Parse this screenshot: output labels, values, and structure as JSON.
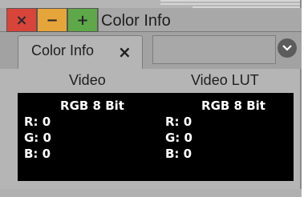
{
  "window": {
    "title": "Color Info",
    "buttons": {
      "close": "×",
      "minimize": "−",
      "maximize": "+"
    }
  },
  "tabs": {
    "active_label": "Color Info",
    "close_symbol": "×"
  },
  "columns": {
    "left_header": "Video",
    "right_header": "Video LUT"
  },
  "readout": {
    "left": {
      "format": "RGB 8 Bit",
      "r": "R: 0",
      "g": "G: 0",
      "b": "B: 0"
    },
    "right": {
      "format": "RGB 8 Bit",
      "r": "R: 0",
      "g": "G: 0",
      "b": "B: 0"
    }
  },
  "colors": {
    "close": "#d9443a",
    "minimize": "#e6a53a",
    "maximize": "#5ea84a",
    "panel": "#b5b5b5",
    "readout_bg": "#000000"
  },
  "icons": {
    "close": "close-icon",
    "minimize": "minimize-icon",
    "maximize": "maximize-icon",
    "menu": "chevron-down-icon"
  }
}
